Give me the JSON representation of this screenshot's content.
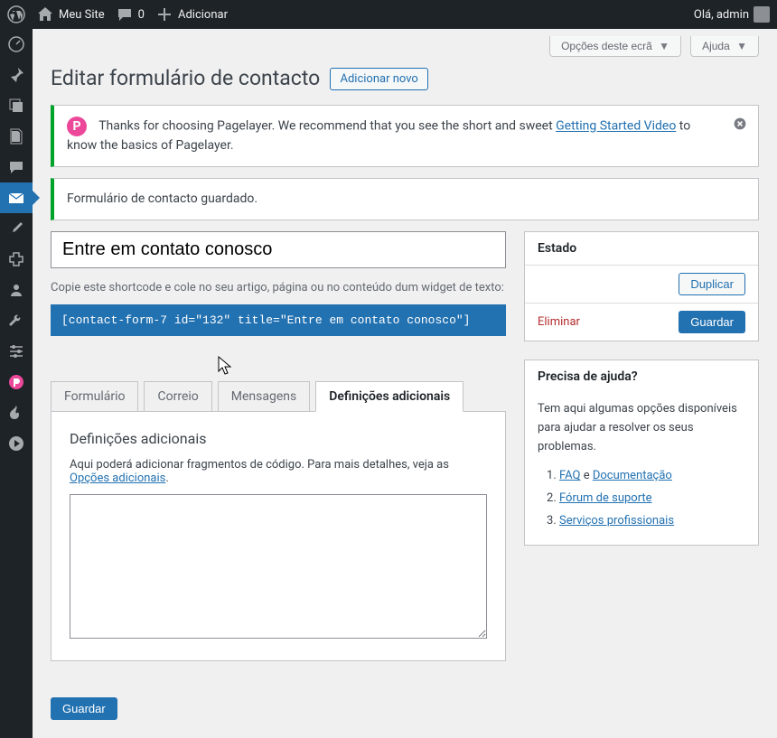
{
  "admin_bar": {
    "site_name": "Meu Site",
    "comments_count": "0",
    "add_new": "Adicionar",
    "greeting": "Olá, admin"
  },
  "top_actions": {
    "screen_options": "Opções deste ecrã",
    "help": "Ajuda"
  },
  "page": {
    "title": "Editar formulário de contacto",
    "add_new": "Adicionar novo"
  },
  "pagelayer_notice": {
    "text_before": "Thanks for choosing Pagelayer. We recommend that you see the short and sweet ",
    "link_text": "Getting Started Video",
    "text_after": " to know the basics of Pagelayer."
  },
  "saved_notice": "Formulário de contacto guardado.",
  "form": {
    "title_value": "Entre em contato conosco",
    "shortcode_help": "Copie este shortcode e cole no seu artigo, página ou no conteúdo dum widget de texto:",
    "shortcode": "[contact-form-7 id=\"132\" title=\"Entre em contato conosco\"]"
  },
  "tabs": {
    "form": "Formulário",
    "mail": "Correio",
    "messages": "Mensagens",
    "additional": "Definições adicionais"
  },
  "panel": {
    "heading": "Definições adicionais",
    "desc_before": "Aqui poderá adicionar fragmentos de código. Para mais detalhes, veja as ",
    "desc_link": "Opções adicionais",
    "desc_after": "."
  },
  "status_box": {
    "title": "Estado",
    "duplicate": "Duplicar",
    "delete": "Eliminar",
    "save": "Guardar"
  },
  "help_box": {
    "title": "Precisa de ajuda?",
    "intro": "Tem aqui algumas opções disponíveis para ajudar a resolver os seus problemas.",
    "items": [
      {
        "link1": "FAQ",
        "mid": " e ",
        "link2": "Documentação"
      },
      {
        "link1": "Fórum de suporte"
      },
      {
        "link1": "Serviços profissionais"
      }
    ]
  },
  "bottom": {
    "save": "Guardar"
  }
}
